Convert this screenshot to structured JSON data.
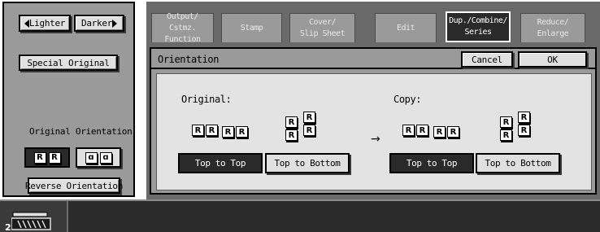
{
  "left_panel": {
    "lighter_label": "Lighter",
    "darker_label": "Darker",
    "special_original_label": "Special Original",
    "original_orientation_label": "Original Orientation",
    "orientation_choices": [
      {
        "glyph_a": "R",
        "glyph_b": "R",
        "selected": true
      },
      {
        "glyph_a": "ɑ",
        "glyph_b": "ɑ",
        "selected": false
      }
    ],
    "reverse_orientation_label": "Reverse Orientation"
  },
  "tabs": [
    {
      "line1": "Output/",
      "line2": "Cstmz. Function",
      "active": false
    },
    {
      "line1": "Stamp",
      "line2": "",
      "active": false
    },
    {
      "line1": "Cover/",
      "line2": "Slip Sheet",
      "active": false
    },
    {
      "line1": "Edit",
      "line2": "",
      "active": false
    },
    {
      "line1": "Dup./Combine/",
      "line2": "Series",
      "active": true
    },
    {
      "line1": "Reduce/",
      "line2": "Enlarge",
      "active": false
    }
  ],
  "dialog": {
    "title": "Orientation",
    "cancel_label": "Cancel",
    "ok_label": "OK",
    "original_label": "Original:",
    "copy_label": "Copy:",
    "arrow_glyph": "→",
    "page_glyph": "R",
    "original_options": [
      {
        "label": "Top to Top",
        "selected": true
      },
      {
        "label": "Top to Bottom",
        "selected": false
      }
    ],
    "copy_options": [
      {
        "label": "Top to Top",
        "selected": true
      },
      {
        "label": "Top to Bottom",
        "selected": false
      }
    ]
  },
  "bottom_bar": {
    "counter_digit": "2"
  },
  "colors": {
    "panel_gray": "#9a9a9a",
    "dark_gray": "#6a6a6a",
    "selected_dark": "#2a2a2a",
    "button_light": "#e0e0e0",
    "content_bg": "#e3e3e3"
  }
}
